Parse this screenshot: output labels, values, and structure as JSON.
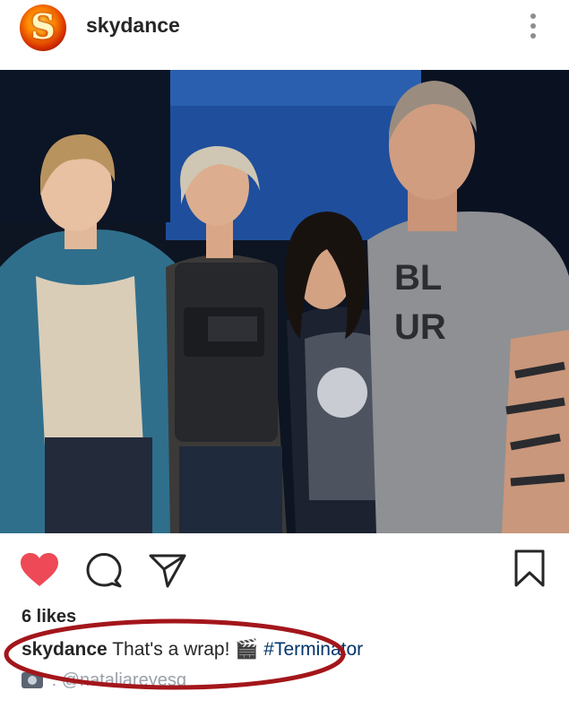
{
  "post": {
    "username": "skydance",
    "avatar_letter": "S",
    "likes": "6 likes",
    "caption": {
      "username": "skydance",
      "text": "That's a wrap!",
      "emoji": "🎬",
      "hashtag": "#Terminator"
    },
    "tag": "@nataliareyesg"
  },
  "photo": {
    "shirt_text_line1": "BL",
    "shirt_text_line2": "UR"
  },
  "icons": {
    "like": "heart-icon",
    "comment": "comment-icon",
    "share": "send-icon",
    "save": "bookmark-icon",
    "more": "more-icon"
  },
  "colors": {
    "like": "#ed4956",
    "annotation": "#a3161b",
    "hashtag": "#003569"
  }
}
